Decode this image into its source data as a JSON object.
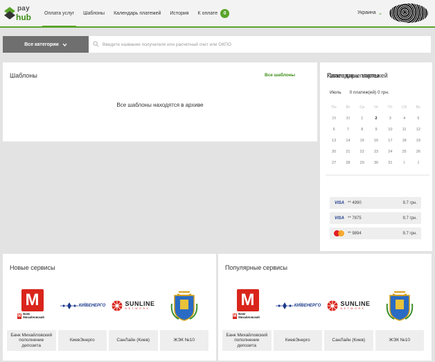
{
  "header": {
    "logo": {
      "pay": "pay",
      "hub": "hub"
    },
    "nav": [
      {
        "label": "Оплата услуг",
        "active": true
      },
      {
        "label": "Шаблоны"
      },
      {
        "label": "Календарь платежей"
      },
      {
        "label": "История"
      },
      {
        "label": "К оплате",
        "badge": "0"
      }
    ],
    "region": "Украина",
    "accent": "#5aa42a"
  },
  "search": {
    "category_label": "Все категории",
    "placeholder": "Введите название получателя или расчетный счет или ОКПО"
  },
  "templates": {
    "title": "Шаблоны",
    "all_link": "Все шаблоны",
    "archived_message": "Все шаблоны находятся в архиве"
  },
  "calendar": {
    "title": "Календарь платежей",
    "month": "Июль",
    "summary": "0 платеж(ей) 0 грн.",
    "weekdays": [
      "Пн",
      "Вт",
      "Ср",
      "Чт",
      "Пт",
      "Сб",
      "Вс"
    ],
    "weeks": [
      [
        "29",
        "30",
        "1",
        "2",
        "3",
        "4",
        "5"
      ],
      [
        "6",
        "7",
        "8",
        "9",
        "10",
        "11",
        "12"
      ],
      [
        "13",
        "14",
        "15",
        "16",
        "17",
        "18",
        "19"
      ],
      [
        "20",
        "21",
        "22",
        "23",
        "24",
        "25",
        "26"
      ],
      [
        "27",
        "28",
        "29",
        "30",
        "31",
        "1",
        "2"
      ]
    ],
    "today": "2"
  },
  "cards": {
    "title": "Платежные карты",
    "items": [
      {
        "type": "visa",
        "brand": "VISA",
        "number": "** 4990",
        "amount": "9.7 грн."
      },
      {
        "type": "visa",
        "brand": "VISA",
        "number": "** 7875",
        "amount": "9.7 грн."
      },
      {
        "type": "mastercard",
        "brand": "",
        "number": "** 9894",
        "amount": "9.7 грн."
      }
    ]
  },
  "new_services": {
    "title": "Новые сервисы",
    "items": [
      {
        "name": "Банк Михайловский пополнение депозита",
        "logo": "bank-mikhailovsky-logo",
        "logo_text": "Банк Михайловский"
      },
      {
        "name": "КиевЭнерго",
        "logo": "kievenergo-logo",
        "logo_text": "КИЇВЕНЕРГО"
      },
      {
        "name": "СанЛайн (Киев)",
        "logo": "sunline-logo",
        "logo_text": "SUNLINE",
        "logo_sub": "NETWORK"
      },
      {
        "name": "ЖЭК №10",
        "logo": "coat-of-arms-icon"
      }
    ]
  },
  "popular_services": {
    "title": "Популярные сервисы",
    "items": [
      {
        "name": "Банк Михайловский пополнение депозита",
        "logo": "bank-mikhailovsky-logo",
        "logo_text": "Банк Михайловский"
      },
      {
        "name": "КиевЭнерго",
        "logo": "kievenergo-logo",
        "logo_text": "КИЇВЕНЕРГО"
      },
      {
        "name": "СанЛайн (Киев)",
        "logo": "sunline-logo",
        "logo_text": "SUNLINE",
        "logo_sub": "NETWORK"
      },
      {
        "name": "ЖЭК №10",
        "logo": "coat-of-arms-icon"
      }
    ]
  }
}
